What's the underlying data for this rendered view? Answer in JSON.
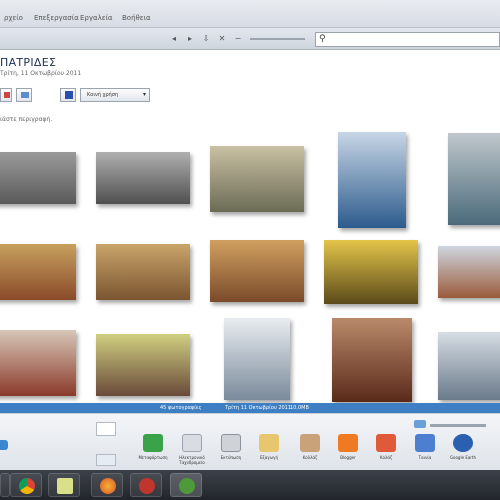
{
  "menubar": {
    "items": [
      {
        "label": "ρχείο",
        "x_hint": "file"
      },
      {
        "label": "Επεξεργασία",
        "x_hint": "edit"
      },
      {
        "label": "Εργαλεία",
        "x_hint": "tools"
      },
      {
        "label": "Βοήθεια",
        "x_hint": "help"
      }
    ]
  },
  "toolbar": {
    "search_placeholder": ""
  },
  "album": {
    "title": "ΠΑΤΡΙΔΕΣ",
    "date": "Τρίτη, 11 Οκτωβρίου 2011",
    "share_label": "Κοινή χρήση",
    "description_placeholder": "ιάστε περιγραφή."
  },
  "status": {
    "count": "45 φωτογραφίες",
    "date": "Τρίτη 11 Οκτωβρίου 2011",
    "size": "10,0MB"
  },
  "bottom_actions": [
    {
      "label": "Μεταφόρτωση",
      "icon": "upload-arrow-icon",
      "color": "#3aa34a"
    },
    {
      "label": "Ηλεκτρονικό Ταχυδρομείο",
      "icon": "email-icon",
      "color": "#d9dde3"
    },
    {
      "label": "Εκτύπωση",
      "icon": "printer-icon",
      "color": "#cfd3d8"
    },
    {
      "label": "Εξαγωγή",
      "icon": "folder-icon",
      "color": "#e8c66d"
    },
    {
      "label": "Κολλάζ",
      "icon": "collage-icon",
      "color": "#c9a27a"
    },
    {
      "label": "Blogger",
      "icon": "blogger-icon",
      "color": "#f07a21"
    },
    {
      "label": "Κολάζ",
      "icon": "picture-icon",
      "color": "#e05a3a"
    },
    {
      "label": "Ταινία",
      "icon": "movie-icon",
      "color": "#4d7fd1"
    },
    {
      "label": "Google Earth",
      "icon": "globe-icon",
      "color": "#2b5fb0"
    }
  ],
  "photos": [
    {
      "name": "photo-1",
      "tone": [
        "#5a5a5a",
        "#9a9a9a"
      ]
    },
    {
      "name": "photo-2",
      "tone": [
        "#4f4f4f",
        "#b0b0b0"
      ]
    },
    {
      "name": "photo-3",
      "tone": [
        "#6b6b55",
        "#c9c1a3"
      ]
    },
    {
      "name": "photo-4",
      "tone": [
        "#2c5b8c",
        "#c8d6e6"
      ]
    },
    {
      "name": "photo-5",
      "tone": [
        "#4a6a7a",
        "#c0c8cc"
      ]
    },
    {
      "name": "photo-6",
      "tone": [
        "#8a4a2a",
        "#c7a15e"
      ]
    },
    {
      "name": "photo-7",
      "tone": [
        "#7a5530",
        "#c9a46a"
      ]
    },
    {
      "name": "photo-8",
      "tone": [
        "#7a4a2a",
        "#d0a060"
      ]
    },
    {
      "name": "photo-9",
      "tone": [
        "#5a4a1a",
        "#e3c54a"
      ]
    },
    {
      "name": "photo-10",
      "tone": [
        "#9a5a3a",
        "#cfd6e0"
      ]
    },
    {
      "name": "photo-11",
      "tone": [
        "#8a3a2a",
        "#d8c7b8"
      ]
    },
    {
      "name": "photo-12",
      "tone": [
        "#6a4a3a",
        "#cfcf80"
      ]
    },
    {
      "name": "photo-13",
      "tone": [
        "#7a8a9a",
        "#e9edf1"
      ]
    },
    {
      "name": "photo-14",
      "tone": [
        "#5a2a1a",
        "#b98a6a"
      ]
    },
    {
      "name": "photo-15",
      "tone": [
        "#6a7a8a",
        "#d6dde4"
      ]
    }
  ]
}
